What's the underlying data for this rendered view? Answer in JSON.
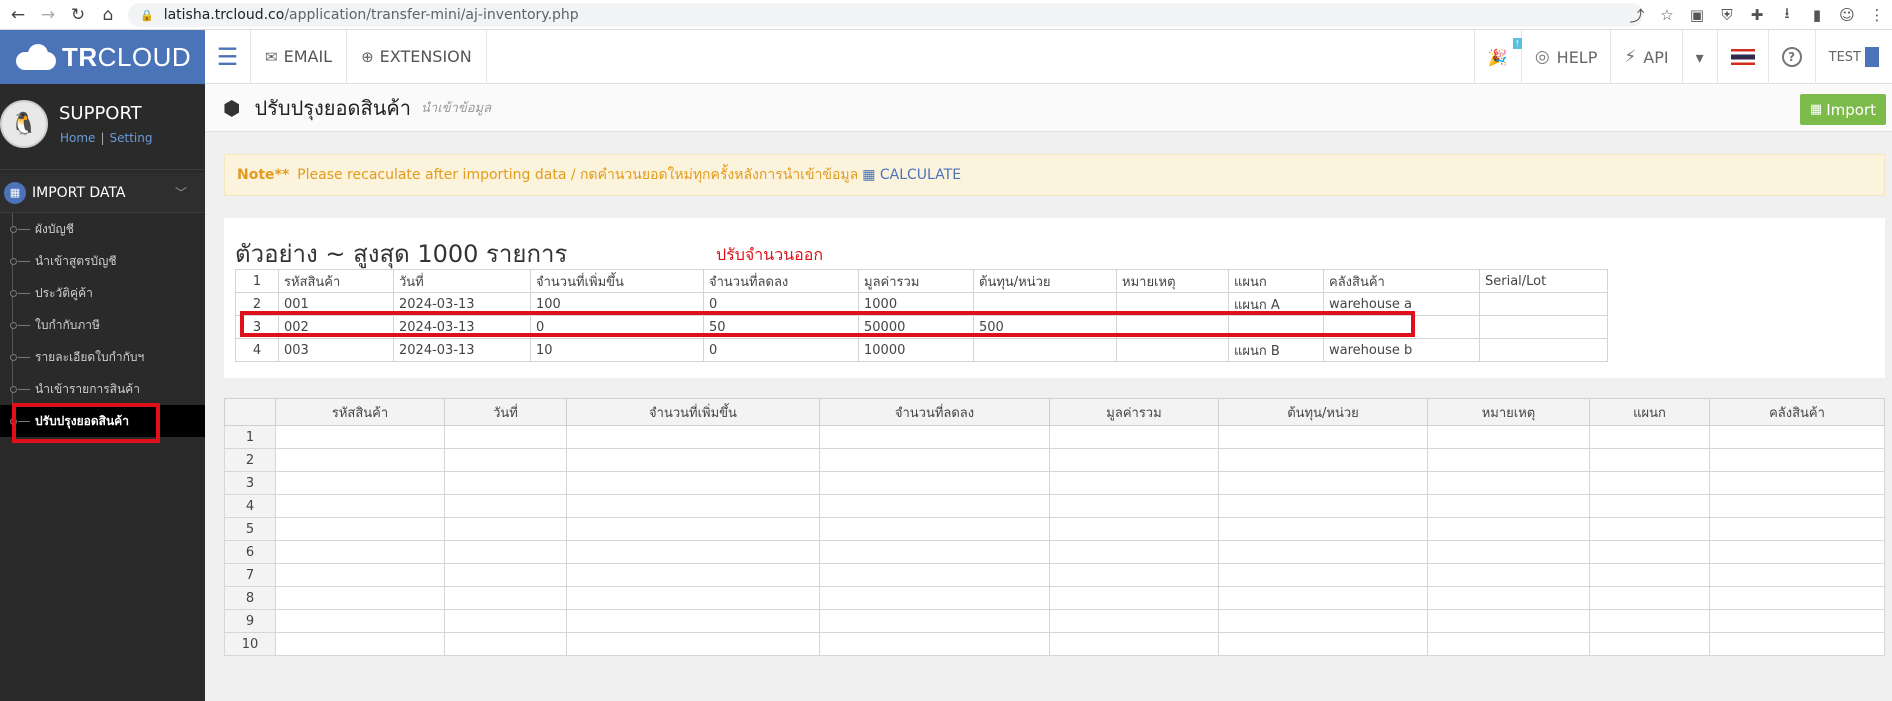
{
  "browser": {
    "url_host": "latisha.trcloud.co",
    "url_path": "/application/transfer-mini/aj-inventory.php"
  },
  "app": {
    "logo_bold": "TR",
    "logo_rest": "CLOUD",
    "topnav": {
      "email": "EMAIL",
      "extension": "EXTENSION"
    },
    "topright": {
      "badge": "!",
      "help": "HELP",
      "api": "API",
      "user": "TEST"
    }
  },
  "sidebar": {
    "profile_name": "SUPPORT",
    "home_link": "Home",
    "link_sep": "|",
    "setting_link": "Setting",
    "section_title": "IMPORT DATA",
    "items": [
      {
        "label": "ผังบัญชี"
      },
      {
        "label": "นำเข้าสูตรบัญชี"
      },
      {
        "label": "ประวัติคู่ค้า"
      },
      {
        "label": "ใบกำกับภาษี"
      },
      {
        "label": "รายละเอียดใบกำกับฯ"
      },
      {
        "label": "นำเข้ารายการสินค้า"
      },
      {
        "label": "ปรับปรุงยอดสินค้า"
      }
    ]
  },
  "page": {
    "title": "ปรับปรุงยอดสินค้า",
    "subtitle": "นำเข้าข้อมูล",
    "import_button": "Import"
  },
  "note": {
    "label": "Note**",
    "text": "Please recaculate after importing data / กดคำนวนยอดใหม่ทุกครั้งหลังการนำเข้าข้อมูล",
    "calc_label": "CALCULATE"
  },
  "example": {
    "title": "ตัวอย่าง ~ สูงสุด 1000 รายการ",
    "annotation": "ปรับจำนวนออก",
    "rows": [
      [
        "1",
        "รหัสสินค้า",
        "วันที่",
        "จำนวนที่เพิ่มขึ้น",
        "จำนวนที่ลดลง",
        "มูลค่ารวม",
        "ต้นทุน/หน่วย",
        "หมายเหตุ",
        "แผนก",
        "คลังสินค้า",
        "Serial/Lot"
      ],
      [
        "2",
        "001",
        "2024-03-13",
        "100",
        "0",
        "1000",
        "",
        "",
        "แผนก A",
        "warehouse a",
        ""
      ],
      [
        "3",
        "002",
        "2024-03-13",
        "0",
        "50",
        "50000",
        "500",
        "",
        "",
        "",
        ""
      ],
      [
        "4",
        "003",
        "2024-03-13",
        "10",
        "0",
        "10000",
        "",
        "",
        "แผนก B",
        "warehouse b",
        ""
      ]
    ]
  },
  "grid": {
    "headers": [
      "รหัสสินค้า",
      "วันที่",
      "จำนวนที่เพิ่มขึ้น",
      "จำนวนที่ลดลง",
      "มูลค่ารวม",
      "ต้นทุน/หน่วย",
      "หมายเหตุ",
      "แผนก",
      "คลังสินค้า"
    ],
    "row_numbers": [
      "1",
      "2",
      "3",
      "4",
      "5",
      "6",
      "7",
      "8",
      "9",
      "10"
    ]
  }
}
